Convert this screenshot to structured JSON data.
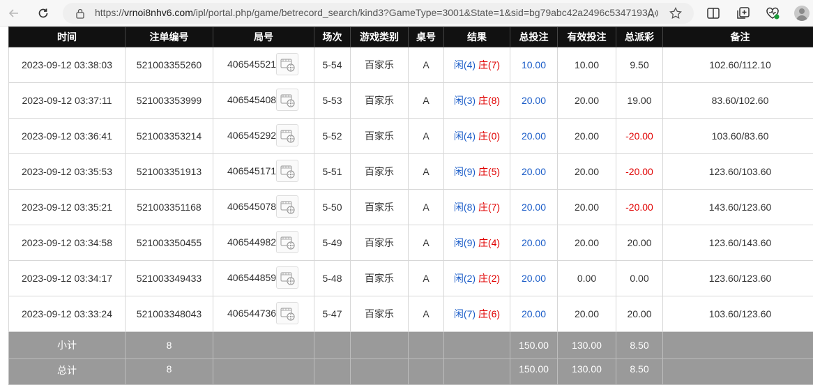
{
  "browser": {
    "url_host": "vrnoi8nhv6.com",
    "url_path": "/ipl/portal.php/game/betrecord_search/kind3?GameType=3001&State=1&sid=bg79abc42a2496c5347193..."
  },
  "table": {
    "headers": [
      "时间",
      "注单编号",
      "局号",
      "场次",
      "游戏类别",
      "桌号",
      "结果",
      "总投注",
      "有效投注",
      "总派彩",
      "备注"
    ],
    "rows": [
      {
        "time": "2023-09-12 03:38:03",
        "bet_id": "521003355260",
        "round": "406545521",
        "session": "5-54",
        "game": "百家乐",
        "table": "A",
        "xian": "闲(4)",
        "zhuang": "庄(7)",
        "total_bet": "10.00",
        "valid_bet": "10.00",
        "payout": "9.50",
        "payout_neg": false,
        "note": "102.60/112.10"
      },
      {
        "time": "2023-09-12 03:37:11",
        "bet_id": "521003353999",
        "round": "406545408",
        "session": "5-53",
        "game": "百家乐",
        "table": "A",
        "xian": "闲(3)",
        "zhuang": "庄(8)",
        "total_bet": "20.00",
        "valid_bet": "20.00",
        "payout": "19.00",
        "payout_neg": false,
        "note": "83.60/102.60"
      },
      {
        "time": "2023-09-12 03:36:41",
        "bet_id": "521003353214",
        "round": "406545292",
        "session": "5-52",
        "game": "百家乐",
        "table": "A",
        "xian": "闲(4)",
        "zhuang": "庄(0)",
        "total_bet": "20.00",
        "valid_bet": "20.00",
        "payout": "-20.00",
        "payout_neg": true,
        "note": "103.60/83.60"
      },
      {
        "time": "2023-09-12 03:35:53",
        "bet_id": "521003351913",
        "round": "406545171",
        "session": "5-51",
        "game": "百家乐",
        "table": "A",
        "xian": "闲(9)",
        "zhuang": "庄(5)",
        "total_bet": "20.00",
        "valid_bet": "20.00",
        "payout": "-20.00",
        "payout_neg": true,
        "note": "123.60/103.60"
      },
      {
        "time": "2023-09-12 03:35:21",
        "bet_id": "521003351168",
        "round": "406545078",
        "session": "5-50",
        "game": "百家乐",
        "table": "A",
        "xian": "闲(8)",
        "zhuang": "庄(7)",
        "total_bet": "20.00",
        "valid_bet": "20.00",
        "payout": "-20.00",
        "payout_neg": true,
        "note": "143.60/123.60"
      },
      {
        "time": "2023-09-12 03:34:58",
        "bet_id": "521003350455",
        "round": "406544982",
        "session": "5-49",
        "game": "百家乐",
        "table": "A",
        "xian": "闲(9)",
        "zhuang": "庄(4)",
        "total_bet": "20.00",
        "valid_bet": "20.00",
        "payout": "20.00",
        "payout_neg": false,
        "note": "123.60/143.60"
      },
      {
        "time": "2023-09-12 03:34:17",
        "bet_id": "521003349433",
        "round": "406544859",
        "session": "5-48",
        "game": "百家乐",
        "table": "A",
        "xian": "闲(2)",
        "zhuang": "庄(2)",
        "total_bet": "20.00",
        "valid_bet": "0.00",
        "payout": "0.00",
        "payout_neg": false,
        "note": "123.60/123.60"
      },
      {
        "time": "2023-09-12 03:33:24",
        "bet_id": "521003348043",
        "round": "406544736",
        "session": "5-47",
        "game": "百家乐",
        "table": "A",
        "xian": "闲(7)",
        "zhuang": "庄(6)",
        "total_bet": "20.00",
        "valid_bet": "20.00",
        "payout": "20.00",
        "payout_neg": false,
        "note": "103.60/123.60"
      }
    ],
    "subtotal": {
      "label": "小计",
      "count": "8",
      "total_bet": "150.00",
      "valid_bet": "130.00",
      "payout": "8.50"
    },
    "total": {
      "label": "总计",
      "count": "8",
      "total_bet": "150.00",
      "valid_bet": "130.00",
      "payout": "8.50"
    }
  },
  "colors": {
    "header_bg": "#111111",
    "link_blue": "#1a5cc8",
    "negative_red": "#e00000",
    "summary_bg": "#9a9a9a"
  }
}
